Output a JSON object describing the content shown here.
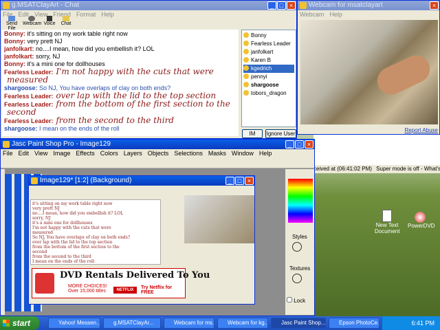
{
  "chat": {
    "title": "g.MSATClayArt - Chat",
    "menu": [
      "File",
      "Edit",
      "View",
      "Friend",
      "Format",
      "Help"
    ],
    "tools": [
      "Send File",
      "Webcam",
      "Voice",
      "Chat"
    ],
    "lines": [
      {
        "n": "Bonny:",
        "t": " it's sitting on my work table right now",
        "s": "s"
      },
      {
        "n": "Bonny:",
        "t": " very prett NJ",
        "s": "s"
      },
      {
        "n": "janfolkart:",
        "t": " no....I mean, how did you embellish it? LOL",
        "s": "s"
      },
      {
        "n": "janfolkart:",
        "t": " sorry, NJ",
        "s": "s"
      },
      {
        "n": "Bonny:",
        "t": " it's a mini one for dollhouses",
        "s": "s"
      },
      {
        "n": "Fearless Leader:",
        "t": " I'm not happy with the cuts that were",
        "s": "b"
      },
      {
        "n": "",
        "t": "measured",
        "s": "b2"
      },
      {
        "n": "shargoose:",
        "t": " So NJ, You have overlaps of clay on both ends?",
        "s": "bl"
      },
      {
        "n": "Fearless Leader:",
        "t": " over lap with the lid to the top section",
        "s": "b"
      },
      {
        "n": "Fearless Leader:",
        "t": " from the bottom of the first section to the",
        "s": "b"
      },
      {
        "n": "",
        "t": "second",
        "s": "b2"
      },
      {
        "n": "Fearless Leader:",
        "t": " from the second to the third",
        "s": "b"
      },
      {
        "n": "shargoose:",
        "t": " I mean on the ends of the roll",
        "s": "bl"
      }
    ],
    "users": [
      "Bonny",
      "Fearless Leader",
      "janfolkart",
      "Karen B",
      "kgedrich",
      "pennyi",
      "shargoose",
      "tobors_dragon"
    ],
    "im": "IM",
    "ignore": "Ignore User"
  },
  "webcam": {
    "title": "Webcam for msatclayart",
    "menu": [
      "Webcam",
      "Help"
    ],
    "report": "Report Abuse",
    "received": "ceived at (06:41:02 PM)",
    "super": "Super mode is off - What's this?"
  },
  "psp": {
    "title": "Jasc Paint Shop Pro - Image129",
    "menu": [
      "File",
      "Edit",
      "View",
      "Image",
      "Effects",
      "Colors",
      "Layers",
      "Objects",
      "Selections",
      "Masks",
      "Window",
      "Help"
    ],
    "image_title": "Image129* [1:2] (Background)",
    "styles": "Styles",
    "textures": "Textures",
    "lock": "Lock",
    "ad_title": "DVD Rentals Delivered To You",
    "ad_sub": "MORE CHOICES! Over 15,000 titles",
    "ad_cta": "Try Netflix for FREE"
  },
  "desktop": {
    "icons": [
      "New Text Document",
      "PowerDVD"
    ]
  },
  "taskbar": {
    "start": "start",
    "items": [
      "Yahoo! Messen...",
      "g.MSATClayAr...",
      "Webcam for ms...",
      "Webcam for kg...",
      "Jasc Paint Shop...",
      "Epson PhotoCe..."
    ],
    "time": "6:41 PM"
  }
}
